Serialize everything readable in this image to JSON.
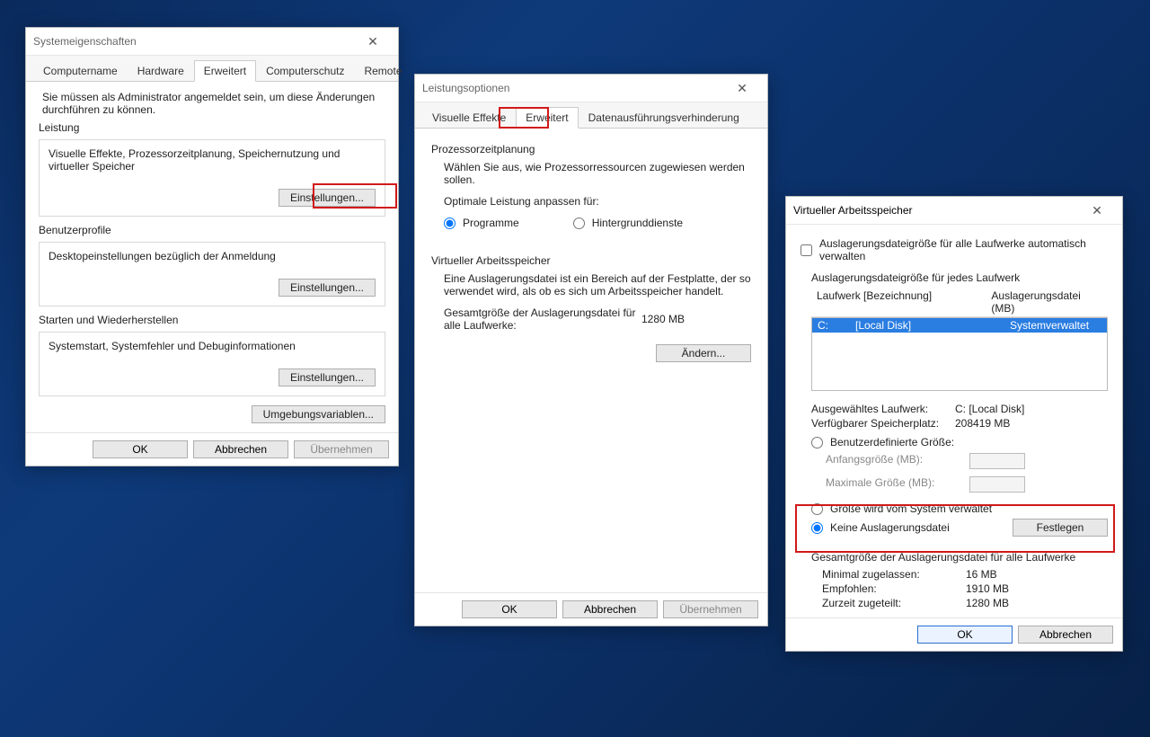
{
  "w1": {
    "title": "Systemeigenschaften",
    "tabs": [
      "Computername",
      "Hardware",
      "Erweitert",
      "Computerschutz",
      "Remote"
    ],
    "active_tab": 2,
    "admin_note": "Sie müssen als Administrator angemeldet sein, um diese Änderungen durchführen zu können.",
    "sections": {
      "leistung": {
        "title": "Leistung",
        "desc": "Visuelle Effekte, Prozessorzeitplanung, Speichernutzung und virtueller Speicher",
        "btn": "Einstellungen..."
      },
      "benutzerprofile": {
        "title": "Benutzerprofile",
        "desc": "Desktopeinstellungen bezüglich der Anmeldung",
        "btn": "Einstellungen..."
      },
      "starten": {
        "title": "Starten und Wiederherstellen",
        "desc": "Systemstart, Systemfehler und Debuginformationen",
        "btn": "Einstellungen..."
      }
    },
    "envbtn": "Umgebungsvariablen...",
    "footer": {
      "ok": "OK",
      "cancel": "Abbrechen",
      "apply": "Übernehmen"
    }
  },
  "w2": {
    "title": "Leistungsoptionen",
    "tabs": [
      "Visuelle Effekte",
      "Erweitert",
      "Datenausführungsverhinderung"
    ],
    "active_tab": 1,
    "proc": {
      "title": "Prozessorzeitplanung",
      "desc": "Wählen Sie aus, wie Prozessorressourcen zugewiesen werden sollen.",
      "optlabel": "Optimale Leistung anpassen für:",
      "opt1": "Programme",
      "opt2": "Hintergrunddienste"
    },
    "vm": {
      "title": "Virtueller Arbeitsspeicher",
      "desc": "Eine Auslagerungsdatei ist ein Bereich auf der Festplatte, der so verwendet wird, als ob es sich um Arbeitsspeicher handelt.",
      "totlabel": "Gesamtgröße der Auslagerungsdatei für alle Laufwerke:",
      "totval": "1280 MB",
      "btn": "Ändern..."
    },
    "footer": {
      "ok": "OK",
      "cancel": "Abbrechen",
      "apply": "Übernehmen"
    }
  },
  "w3": {
    "title": "Virtueller Arbeitsspeicher",
    "auto_cb": "Auslagerungsdateigröße für alle Laufwerke automatisch verwalten",
    "perdrive": "Auslagerungsdateigröße für jedes Laufwerk",
    "hdr1": "Laufwerk [Bezeichnung]",
    "hdr2": "Auslagerungsdatei (MB)",
    "row1a": "C:",
    "row1b": "[Local Disk]",
    "row1c": "Systemverwaltet",
    "seldrive_l": "Ausgewähltes Laufwerk:",
    "seldrive_v": "C:   [Local Disk]",
    "freespace_l": "Verfügbarer Speicherplatz:",
    "freespace_v": "208419 MB",
    "custom": "Benutzerdefinierte Größe:",
    "init": "Anfangsgröße (MB):",
    "max": "Maximale Größe (MB):",
    "sysmgd": "Größe wird vom System verwaltet",
    "nopf": "Keine Auslagerungsdatei",
    "setbtn": "Festlegen",
    "totals_title": "Gesamtgröße der Auslagerungsdatei für alle Laufwerke",
    "min_l": "Minimal zugelassen:",
    "min_v": "16 MB",
    "rec_l": "Empfohlen:",
    "rec_v": "1910 MB",
    "cur_l": "Zurzeit zugeteilt:",
    "cur_v": "1280 MB",
    "footer": {
      "ok": "OK",
      "cancel": "Abbrechen"
    }
  }
}
